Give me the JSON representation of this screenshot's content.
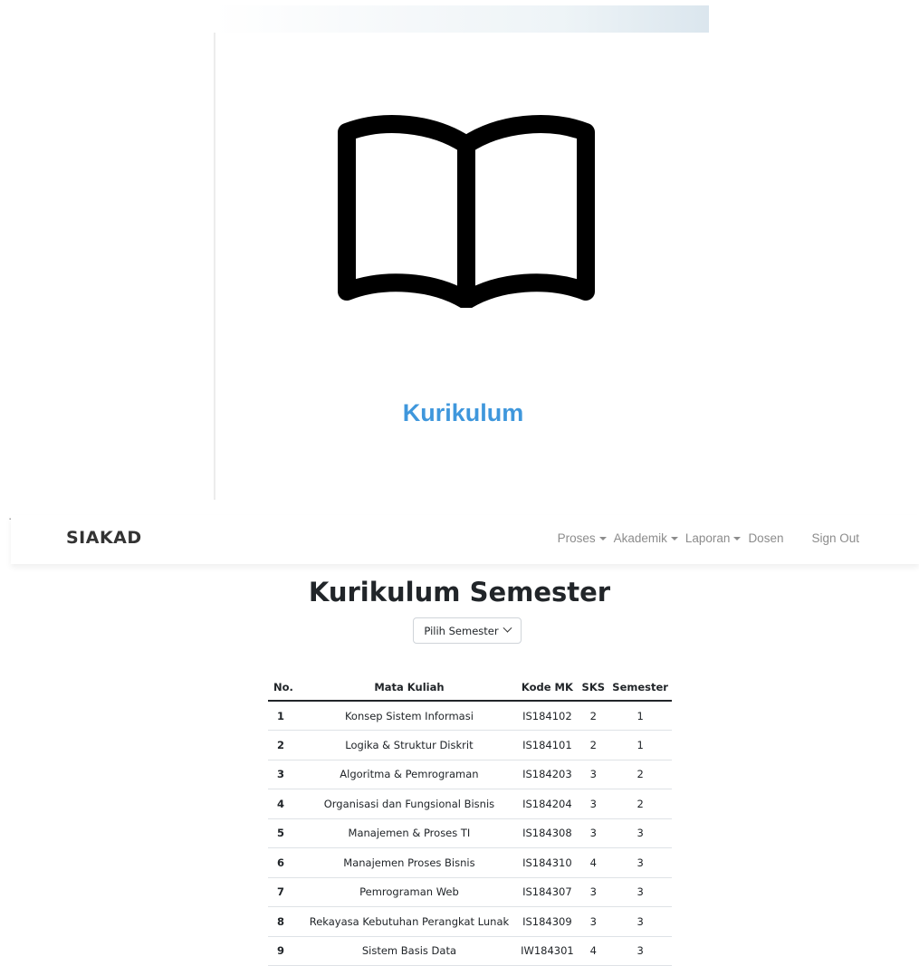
{
  "hero": {
    "label": "Kurikulum",
    "icon": "open-book-icon",
    "label_color": "#3f97dc"
  },
  "dash": "-",
  "navbar": {
    "brand": "SIAKAD",
    "items": [
      {
        "label": "Proses",
        "dropdown": true
      },
      {
        "label": "Akademik",
        "dropdown": true
      },
      {
        "label": "Laporan",
        "dropdown": true
      },
      {
        "label": "Dosen",
        "dropdown": false
      },
      {
        "label": "Sign Out",
        "dropdown": false
      }
    ]
  },
  "main": {
    "title": "Kurikulum Semester",
    "semester_select": "Pilih Semester",
    "table": {
      "headers": [
        "No.",
        "Mata Kuliah",
        "Kode MK",
        "SKS",
        "Semester"
      ],
      "rows": [
        [
          "1",
          "Konsep Sistem Informasi",
          "IS184102",
          "2",
          "1"
        ],
        [
          "2",
          "Logika & Struktur Diskrit",
          "IS184101",
          "2",
          "1"
        ],
        [
          "3",
          "Algoritma & Pemrograman",
          "IS184203",
          "3",
          "2"
        ],
        [
          "4",
          "Organisasi dan Fungsional Bisnis",
          "IS184204",
          "3",
          "2"
        ],
        [
          "5",
          "Manajemen & Proses TI",
          "IS184308",
          "3",
          "3"
        ],
        [
          "6",
          "Manajemen Proses Bisnis",
          "IS184310",
          "4",
          "3"
        ],
        [
          "7",
          "Pemrograman Web",
          "IS184307",
          "3",
          "3"
        ],
        [
          "8",
          "Rekayasa Kebutuhan Perangkat Lunak",
          "IS184309",
          "3",
          "3"
        ],
        [
          "9",
          "Sistem Basis Data",
          "IW184301",
          "4",
          "3"
        ]
      ]
    }
  }
}
